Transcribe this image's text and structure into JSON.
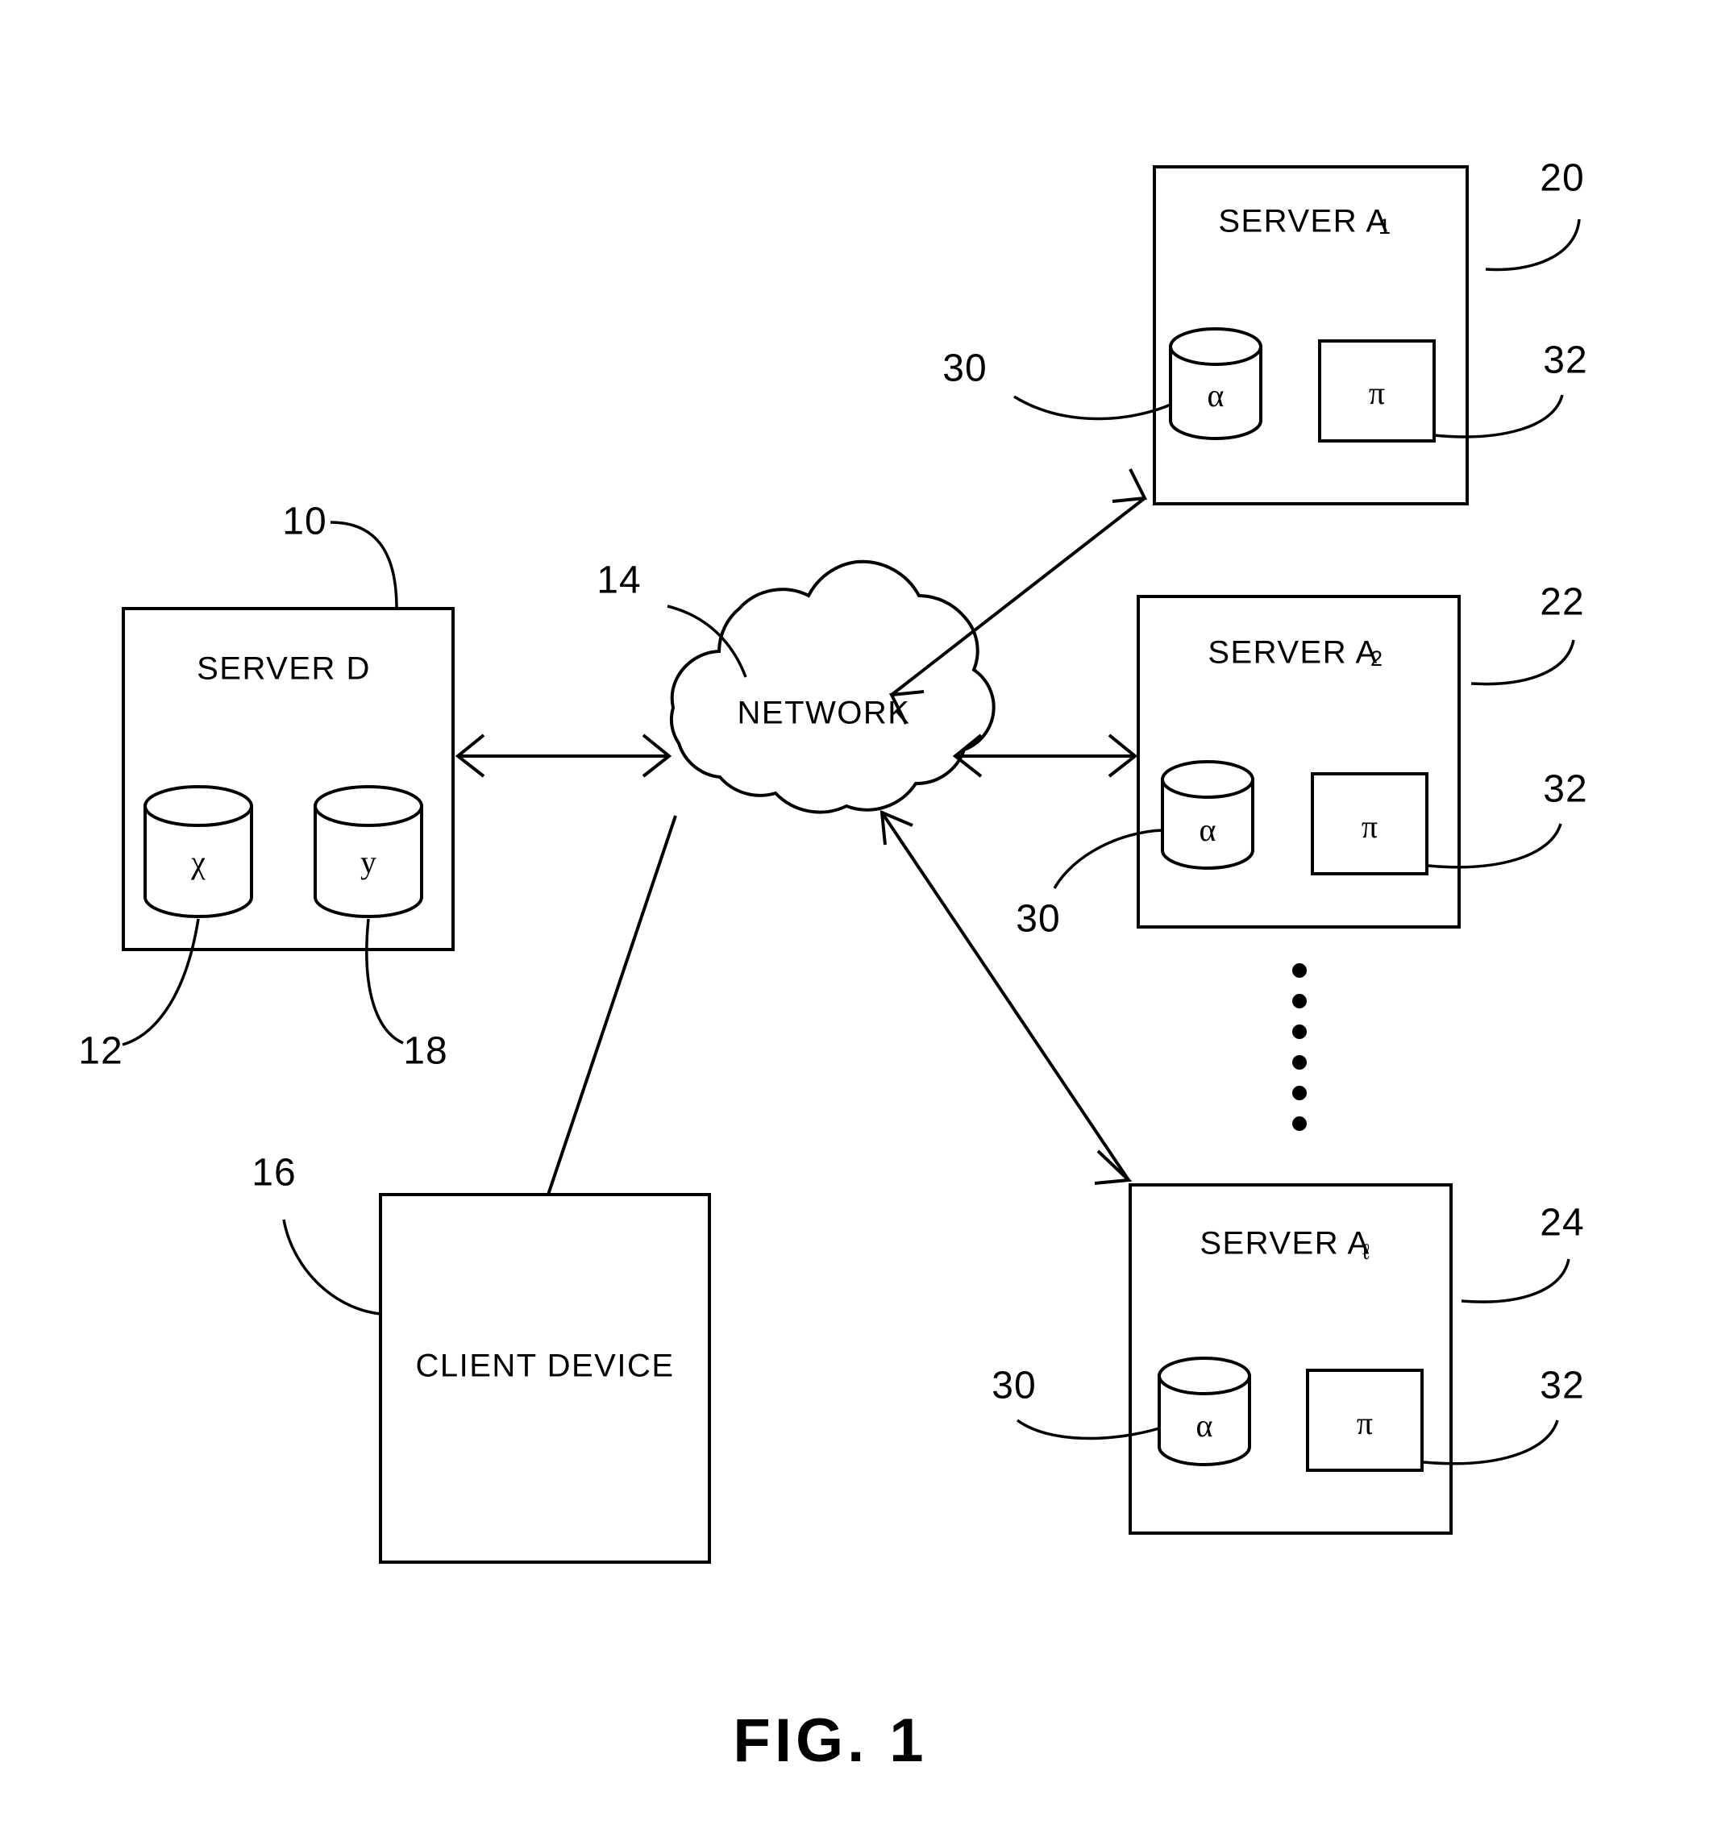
{
  "figure": {
    "caption": "FIG. 1",
    "domain": "patent-network-diagram"
  },
  "nodes": {
    "server_d": {
      "title": "SERVER D",
      "ref": "10",
      "stores": [
        {
          "glyph": "χ",
          "name": "chi-datastore",
          "ref": "12"
        },
        {
          "glyph": "y",
          "name": "y-datastore",
          "ref": "18"
        }
      ]
    },
    "network": {
      "title": "NETWORK",
      "ref": "14"
    },
    "client_device": {
      "title": "CLIENT DEVICE",
      "ref": "16"
    },
    "server_a1": {
      "title": "SERVER A",
      "subscript": "1",
      "ref": "20",
      "datastore_glyph": "α",
      "datastore_ref": "30",
      "module_glyph": "π",
      "module_ref": "32"
    },
    "server_a2": {
      "title": "SERVER A",
      "subscript": "2",
      "ref": "22",
      "datastore_glyph": "α",
      "datastore_ref": "30",
      "module_glyph": "π",
      "module_ref": "32"
    },
    "server_al": {
      "title": "SERVER A",
      "subscript": "ℓ",
      "ref": "24",
      "datastore_glyph": "α",
      "datastore_ref": "30",
      "module_glyph": "π",
      "module_ref": "32"
    }
  },
  "connections": [
    {
      "name": "server-d-to-network",
      "style": "double-arrow"
    },
    {
      "name": "network-to-server-a1",
      "style": "double-arrow"
    },
    {
      "name": "network-to-server-a2",
      "style": "double-arrow"
    },
    {
      "name": "network-to-server-al",
      "style": "double-arrow"
    },
    {
      "name": "client-device-to-network",
      "style": "plain-line"
    }
  ],
  "ellipsis": {
    "name": "vertical-ellipsis",
    "dots": 6
  },
  "colors": {
    "ink": "#000000",
    "paper": "#ffffff"
  }
}
